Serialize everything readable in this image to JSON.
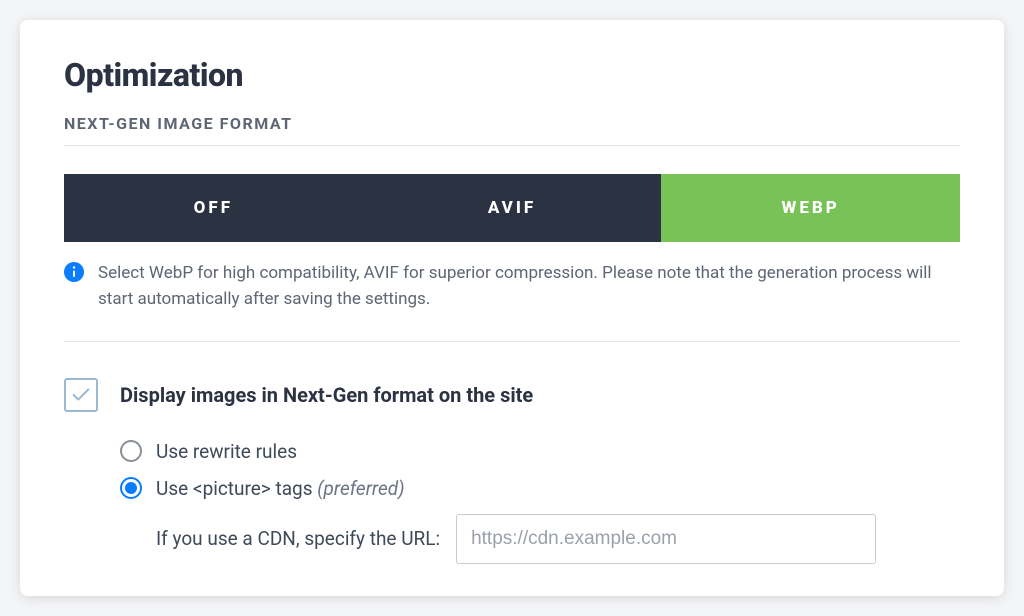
{
  "title": "Optimization",
  "section": "NEXT-GEN IMAGE FORMAT",
  "segments": {
    "off": "OFF",
    "avif": "AVIF",
    "webp": "WEBP"
  },
  "info_text": "Select WebP for high compatibility, AVIF for superior compression. Please note that the generation process will start automatically after saving the settings.",
  "checkbox_label": "Display images in Next-Gen format on the site",
  "radio": {
    "rewrite": "Use rewrite rules",
    "picture_pre": "Use <picture> tags ",
    "picture_hint": "(preferred)"
  },
  "cdn": {
    "label": "If you use a CDN, specify the URL:",
    "placeholder": "https://cdn.example.com",
    "value": ""
  },
  "icons": {
    "info": "info-circle",
    "check": "checkmark"
  },
  "colors": {
    "accent_green": "#78c257",
    "dark": "#2b3241",
    "info_blue": "#0a7cff"
  }
}
